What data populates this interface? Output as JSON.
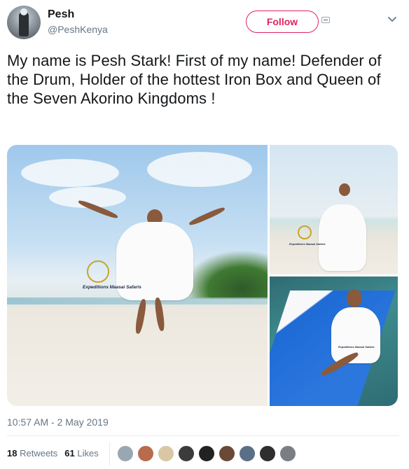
{
  "author": {
    "name": "Pesh",
    "handle": "@PeshKenya"
  },
  "header": {
    "follow_label": "Follow"
  },
  "tweet": {
    "text": "My name is Pesh Stark! First of my name! Defender of the Drum, Holder of the hottest Iron Box and Queen of the Seven Akorino Kingdoms !",
    "timestamp": "10:57 AM - 2 May 2019"
  },
  "media": {
    "watermark_text": "Expeditions Maasai Safaris"
  },
  "stats": {
    "retweets_count": "18",
    "retweets_label": "Retweets",
    "likes_count": "61",
    "likes_label": "Likes"
  },
  "icons": {
    "caret": "chevron-down-icon",
    "follow_extra": "follow-extra-icon"
  },
  "colors": {
    "accent": "#e0245e",
    "secondary_text": "#657786",
    "divider": "#e6ecf0"
  }
}
